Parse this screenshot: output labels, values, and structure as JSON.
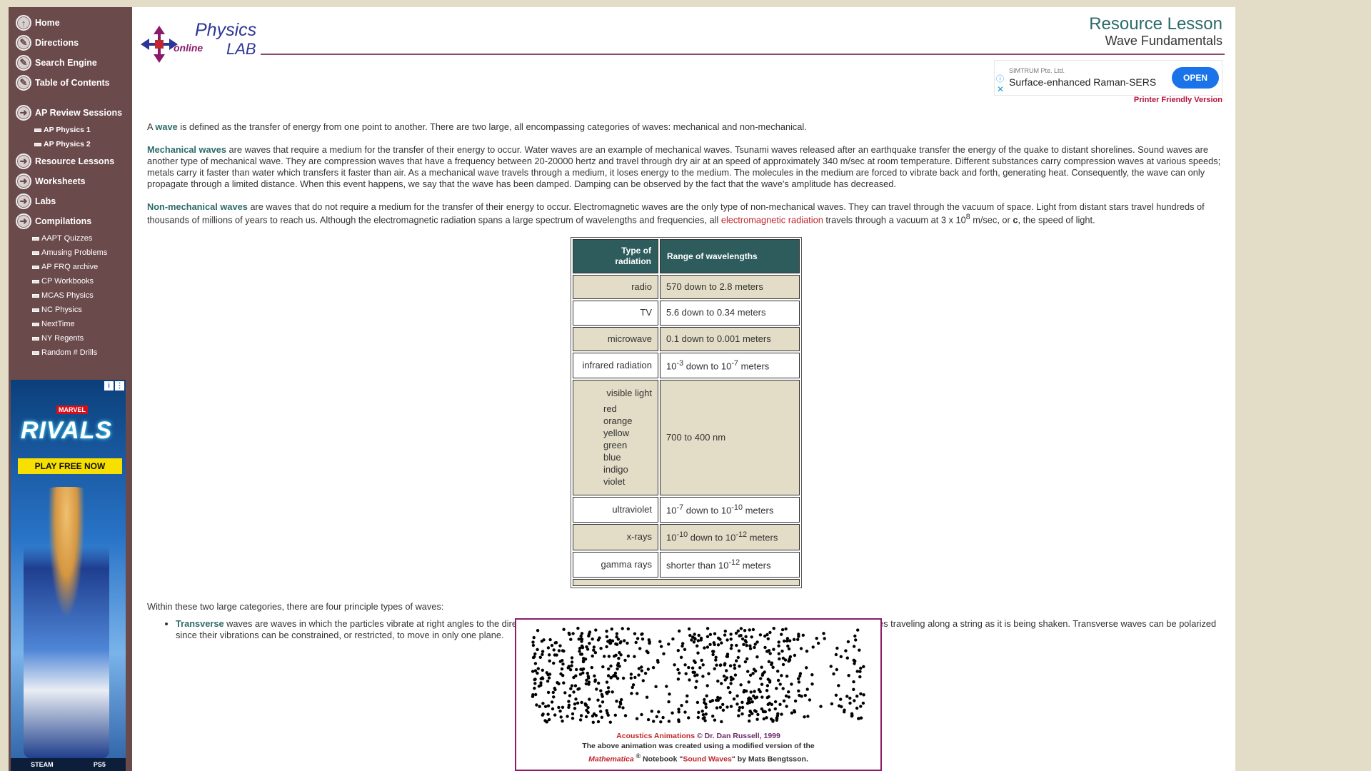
{
  "sidebar": {
    "main_items": [
      {
        "label": "Home",
        "icon": "up-arrow-icon"
      },
      {
        "label": "Directions",
        "icon": "pencil-icon"
      },
      {
        "label": "Search Engine",
        "icon": "pencil-icon"
      },
      {
        "label": "Table of Contents",
        "icon": "pencil-icon"
      }
    ],
    "ap_review": {
      "label": "AP Review Sessions",
      "items": [
        "AP Physics 1",
        "AP Physics 2"
      ]
    },
    "mid_items": [
      "Resource Lessons",
      "Worksheets",
      "Labs",
      "Compilations"
    ],
    "compilations": [
      "AAPT Quizzes",
      "Amusing Problems",
      "AP FRQ archive",
      "CP Workbooks",
      "MCAS Physics",
      "NC Physics",
      "NextTime",
      "NY Regents",
      "Random # Drills"
    ]
  },
  "side_ad": {
    "brand": "MARVEL",
    "title": "RIVALS",
    "cta": "PLAY FREE NOW",
    "platforms": [
      "STEAM",
      "PS5"
    ]
  },
  "logo": {
    "physics": "Physics",
    "lab": "LAB",
    "online": "online"
  },
  "header": {
    "title": "Resource Lesson",
    "subtitle": "Wave Fundamentals"
  },
  "top_ad": {
    "sponsor": "SIMTRUM Pte. Ltd.",
    "headline": "Surface-enhanced Raman-SERS",
    "button": "OPEN"
  },
  "printer_link": "Printer Friendly Version",
  "intro": {
    "a": "A ",
    "wave": "wave",
    "rest": " is defined as the transfer of energy from one point to another. There are two large, all encompassing categories of waves: mechanical and non-mechanical."
  },
  "mechanical": {
    "term": "Mechanical waves",
    "text": " are waves that require a medium for the transfer of their energy to occur. Water waves are an example of mechanical waves. Tsunami waves released after an earthquake transfer the energy of the quake to distant shorelines. Sound waves are another type of  mechanical wave. They are compression waves that have a frequency between 20-20000 hertz and travel through dry air at an speed of approximately 340 m/sec at room temperature. Different substances carry compression waves at various speeds; metals carry it faster than water which transfers it faster than air. As a mechanical wave travels through a medium, it loses energy to the medium. The molecules in the medium are forced to vibrate back and forth, generating heat. Consequently, the wave can only propagate through a limited distance. When this event happens, we say that the wave has been damped. Damping can be observed by the fact that the wave's amplitude has decreased."
  },
  "nonmechanical": {
    "term": "Non-mechanical waves",
    "text": " are waves that do not require a medium for the transfer of their energy to occur. Electromagnetic waves are the only type of non-mechanical waves. They can travel through the vacuum of space. Light from distant stars travel hundreds of thousands of millions of years to reach us. Although the electromagnetic radiation spans a large spectrum of wavelengths and frequencies, all ",
    "link": "electromagnetic radiation",
    "text2": " travels through a vacuum at 3 x 10",
    "exp": "8",
    "text3": " m/sec, or ",
    "c": "c",
    "text4": ", the speed of light."
  },
  "table": {
    "headers": [
      "Type of radiation",
      "Range of wavelengths"
    ],
    "rows": {
      "radio": {
        "type": "radio",
        "range": "570 down to 2.8 meters"
      },
      "tv": {
        "type": "TV",
        "range": "5.6 down to 0.34 meters"
      },
      "microwave": {
        "type": "microwave",
        "range": "0.1 down to 0.001 meters"
      },
      "infrared": {
        "type": "infrared radiation",
        "b1": "10",
        "e1": "-3",
        "mid": " down to 10",
        "e2": "-7",
        "end": " meters"
      },
      "visible": {
        "type": "visible light",
        "colors": [
          "red",
          "orange",
          "yellow",
          "green",
          "blue",
          "indigo",
          "violet"
        ],
        "range": "700 to 400 nm"
      },
      "uv": {
        "type": "ultraviolet",
        "b1": "10",
        "e1": "-7",
        "mid": " down to 10",
        "e2": "-10",
        "end": " meters"
      },
      "xray": {
        "type": "x-rays",
        "b1": "10",
        "e1": "-10",
        "mid": " down to 10",
        "e2": "-12",
        "end": " meters"
      },
      "gamma": {
        "type": "gamma rays",
        "pre": "shorter than 10",
        "e1": "-12",
        "end": " meters"
      }
    }
  },
  "types_intro": "Within these two large categories, there are four principle types of waves:",
  "transverse": {
    "term": "Transverse",
    "text": " waves are waves in which the particles vibrate at right angles to the direction of the wave's velocity or propagation. An example of this type of wave would be pulses traveling along a string as it is being shaken. Transverse waves can be polarized since their vibrations can be constrained, or restricted, to move in only one plane."
  },
  "animation": {
    "credit_link": "Acoustics Animations",
    "credit_rest": " © Dr. Dan Russell, 1999",
    "line2": "The above animation was created using a modified version of the",
    "mathematica": "Mathematica",
    "reg": "®",
    "notebook": " Notebook \"",
    "sound_waves": "Sound Waves",
    "by": "\" by Mats Bengtsson."
  },
  "colors": {
    "sidebar": "#6b4a4c",
    "accent_teal": "#2d6a6a",
    "link_red": "#c1272d",
    "header_teal_bg": "#2e5c5c",
    "beige": "#e3dcc6"
  }
}
